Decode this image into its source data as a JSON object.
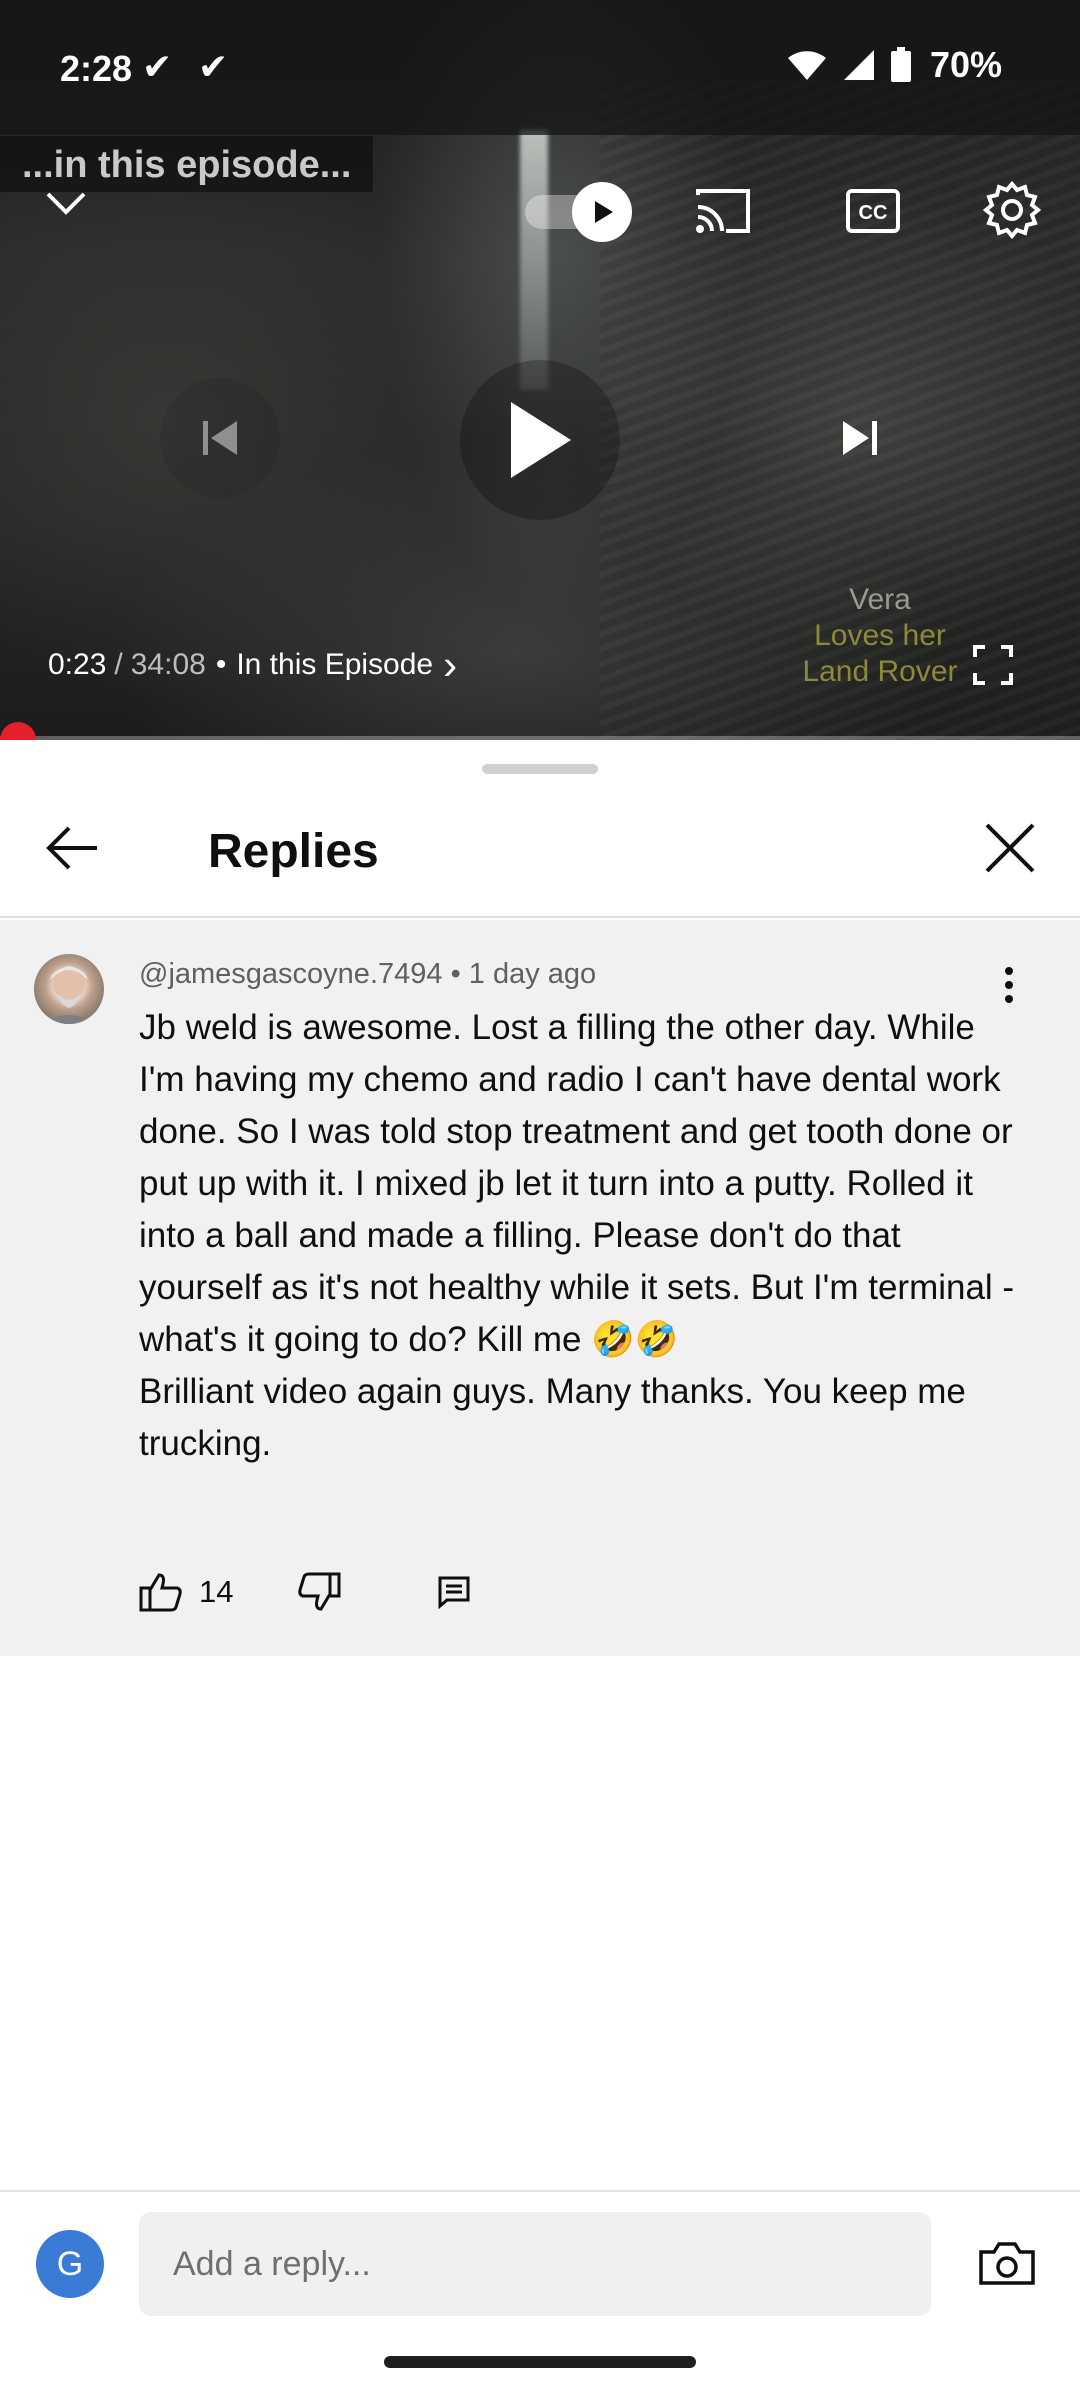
{
  "status_bar": {
    "time": "2:28",
    "check_1": "✔",
    "check_2": "✔",
    "battery": "70%"
  },
  "video": {
    "episode_banner": "...in this episode...",
    "current_time": "0:23",
    "separator": "/",
    "duration": "34:08",
    "bullet": "•",
    "chapter": "In this Episode",
    "chapter_chevron": "›",
    "watermark_line1": "Vera",
    "watermark_line2": "Loves her",
    "watermark_line3": "Land Rover",
    "progress_fraction": 0.011,
    "accent_color": "#ff0000"
  },
  "sheet": {
    "title": "Replies"
  },
  "comment": {
    "author": "@jamesgascoyne.7494",
    "bullet": "•",
    "age": "1 day ago",
    "body": "Jb weld is awesome. Lost a filling the other day. While I'm having my chemo and radio I can't have dental work done. So I was told stop treatment and get tooth done or put up with it. I mixed jb let it turn into a putty. Rolled it into a ball and made a filling. Please don't do that yourself as it's not healthy while it sets. But I'm terminal - what's it going to do? Kill me 🤣🤣\nBrilliant video again guys. Many thanks. You keep me trucking.",
    "like_count": "14"
  },
  "reply_bar": {
    "avatar_initial": "G",
    "placeholder": "Add a reply..."
  },
  "icons": [
    "chevron-down-icon",
    "autoplay-toggle-icon",
    "cast-icon",
    "cc-icon",
    "settings-gear-icon",
    "previous-icon",
    "play-icon",
    "next-icon",
    "fullscreen-icon",
    "back-arrow-icon",
    "close-icon",
    "more-vert-icon",
    "thumb-up-icon",
    "thumb-down-icon",
    "reply-comment-icon",
    "camera-icon",
    "wifi-icon",
    "signal-icon",
    "battery-icon"
  ]
}
